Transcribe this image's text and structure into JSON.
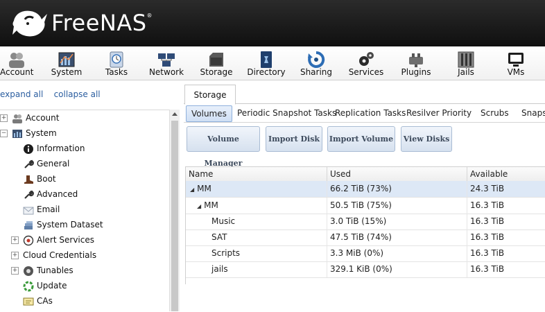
{
  "brand": {
    "name": "FreeNAS",
    "mark": "®"
  },
  "toolbar": [
    {
      "label": "Account",
      "icon": "account-icon"
    },
    {
      "label": "System",
      "icon": "system-icon"
    },
    {
      "label": "Tasks",
      "icon": "tasks-icon"
    },
    {
      "label": "Network",
      "icon": "network-icon"
    },
    {
      "label": "Storage",
      "icon": "storage-icon"
    },
    {
      "label": "Directory",
      "icon": "directory-icon"
    },
    {
      "label": "Sharing",
      "icon": "sharing-icon"
    },
    {
      "label": "Services",
      "icon": "services-icon"
    },
    {
      "label": "Plugins",
      "icon": "plugins-icon"
    },
    {
      "label": "Jails",
      "icon": "jails-icon"
    },
    {
      "label": "VMs",
      "icon": "vms-icon"
    }
  ],
  "tree_controls": {
    "expand": "expand all",
    "collapse": "collapse all"
  },
  "tree": [
    {
      "label": "Account",
      "toggle": "+"
    },
    {
      "label": "System",
      "toggle": "−"
    },
    {
      "label": "Information"
    },
    {
      "label": "General"
    },
    {
      "label": "Boot"
    },
    {
      "label": "Advanced"
    },
    {
      "label": "Email"
    },
    {
      "label": "System Dataset"
    },
    {
      "label": "Alert Services",
      "toggle": "+"
    },
    {
      "label": "Cloud Credentials",
      "toggle": "+"
    },
    {
      "label": "Tunables",
      "toggle": "+"
    },
    {
      "label": "Update"
    },
    {
      "label": "CAs"
    }
  ],
  "main_tab": "Storage",
  "subtabs": [
    "Volumes",
    "Periodic Snapshot Tasks",
    "Replication Tasks",
    "Resilver Priority",
    "Scrubs",
    "Snaps"
  ],
  "buttons": [
    "Volume Manager",
    "Import Disk",
    "Import Volume",
    "View Disks"
  ],
  "table": {
    "columns": [
      "Name",
      "Used",
      "Available"
    ],
    "rows": [
      {
        "name": "MM",
        "used": "66.2 TiB (73%)",
        "available": "24.3 TiB",
        "expander": "◢"
      },
      {
        "name": "MM",
        "used": "50.5 TiB (75%)",
        "available": "16.3 TiB",
        "expander": "◢"
      },
      {
        "name": "Music",
        "used": "3.0 TiB (15%)",
        "available": "16.3 TiB"
      },
      {
        "name": "SAT",
        "used": "47.5 TiB (74%)",
        "available": "16.3 TiB"
      },
      {
        "name": "Scripts",
        "used": "3.3 MiB (0%)",
        "available": "16.3 TiB"
      },
      {
        "name": "jails",
        "used": "329.1 KiB (0%)",
        "available": "16.3 TiB"
      }
    ]
  }
}
